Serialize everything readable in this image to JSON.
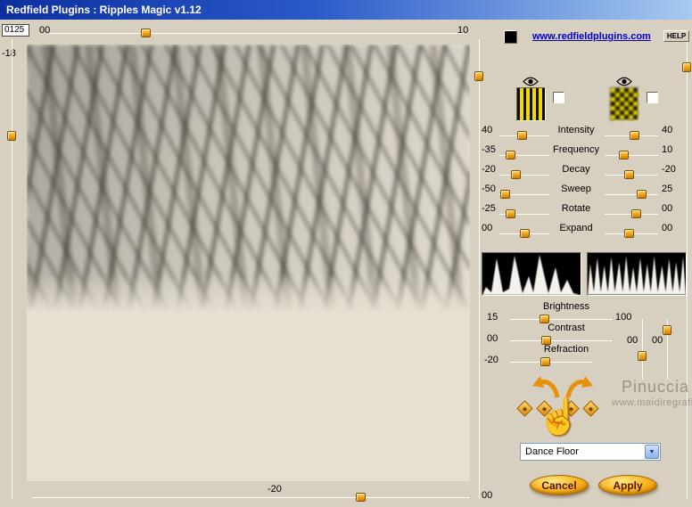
{
  "titlebar": {
    "title": "Redfield Plugins : Ripples Magic v1.12"
  },
  "topbar": {
    "seed": "0125",
    "left_value": "00",
    "right_value": "10"
  },
  "left_slider": {
    "label": "-18"
  },
  "panel_header": {
    "website_link": "www.redfieldplugins.com",
    "help_label": "HELP"
  },
  "params": [
    {
      "name": "Intensity",
      "left": "40",
      "right": "40"
    },
    {
      "name": "Frequency",
      "left": "-35",
      "right": "10"
    },
    {
      "name": "Decay",
      "left": "-20",
      "right": "-20"
    },
    {
      "name": "Sweep",
      "left": "-50",
      "right": "25"
    },
    {
      "name": "Rotate",
      "left": "-25",
      "right": "00"
    },
    {
      "name": "Expand",
      "left": "00",
      "right": "00"
    }
  ],
  "adjustments": {
    "brightness": {
      "label": "Brightness",
      "left": "15",
      "right": "100"
    },
    "contrast": {
      "label": "Contrast",
      "left": "00"
    },
    "refraction": {
      "label": "Refraction",
      "left": "-20"
    }
  },
  "offsets": {
    "x": "00",
    "y": "00"
  },
  "bottom_slider": {
    "label": "-20",
    "right_value": "00"
  },
  "watermark": {
    "name": "Pinuccia",
    "site": "www.maidiregrafica."
  },
  "preset": {
    "value": "Dance Floor"
  },
  "actions": {
    "cancel": "Cancel",
    "apply": "Apply"
  },
  "icons": {
    "dropdown_arrow": "▼",
    "hand": "☝",
    "eye": "eye-icon",
    "texture_1": "vertical-stripes-texture",
    "texture_2": "checker-blur-texture"
  },
  "colors": {
    "accent_gold": "#f0a51d",
    "link_blue": "#0000c8",
    "title_start": "#0d2fa0",
    "title_end": "#a6caf0",
    "panel_beige": "#d7cfbf"
  }
}
